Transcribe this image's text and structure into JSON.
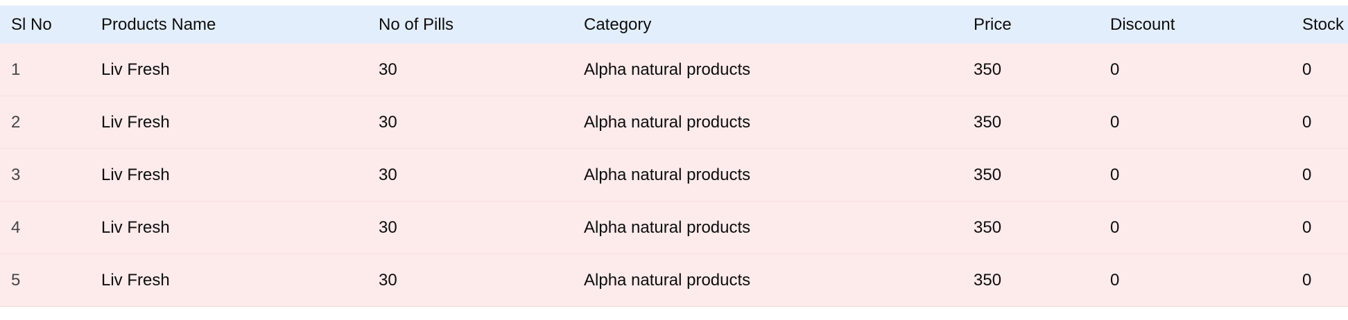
{
  "table": {
    "headers": [
      "Sl No",
      "Products Name",
      "No of Pills",
      "Category",
      "Price",
      "Discount",
      "Stock"
    ],
    "rows": [
      [
        "1",
        "Liv Fresh",
        "30",
        "Alpha natural products",
        "350",
        "0",
        "0"
      ],
      [
        "2",
        "Liv Fresh",
        "30",
        "Alpha natural products",
        "350",
        "0",
        "0"
      ],
      [
        "3",
        "Liv Fresh",
        "30",
        "Alpha natural products",
        "350",
        "0",
        "0"
      ],
      [
        "4",
        "Liv Fresh",
        "30",
        "Alpha natural products",
        "350",
        "0",
        "0"
      ],
      [
        "5",
        "Liv Fresh",
        "30",
        "Alpha natural products",
        "350",
        "0",
        "0"
      ]
    ]
  },
  "colors": {
    "header_bg": "#e3eefc",
    "row_bg": "#fdeaea"
  }
}
